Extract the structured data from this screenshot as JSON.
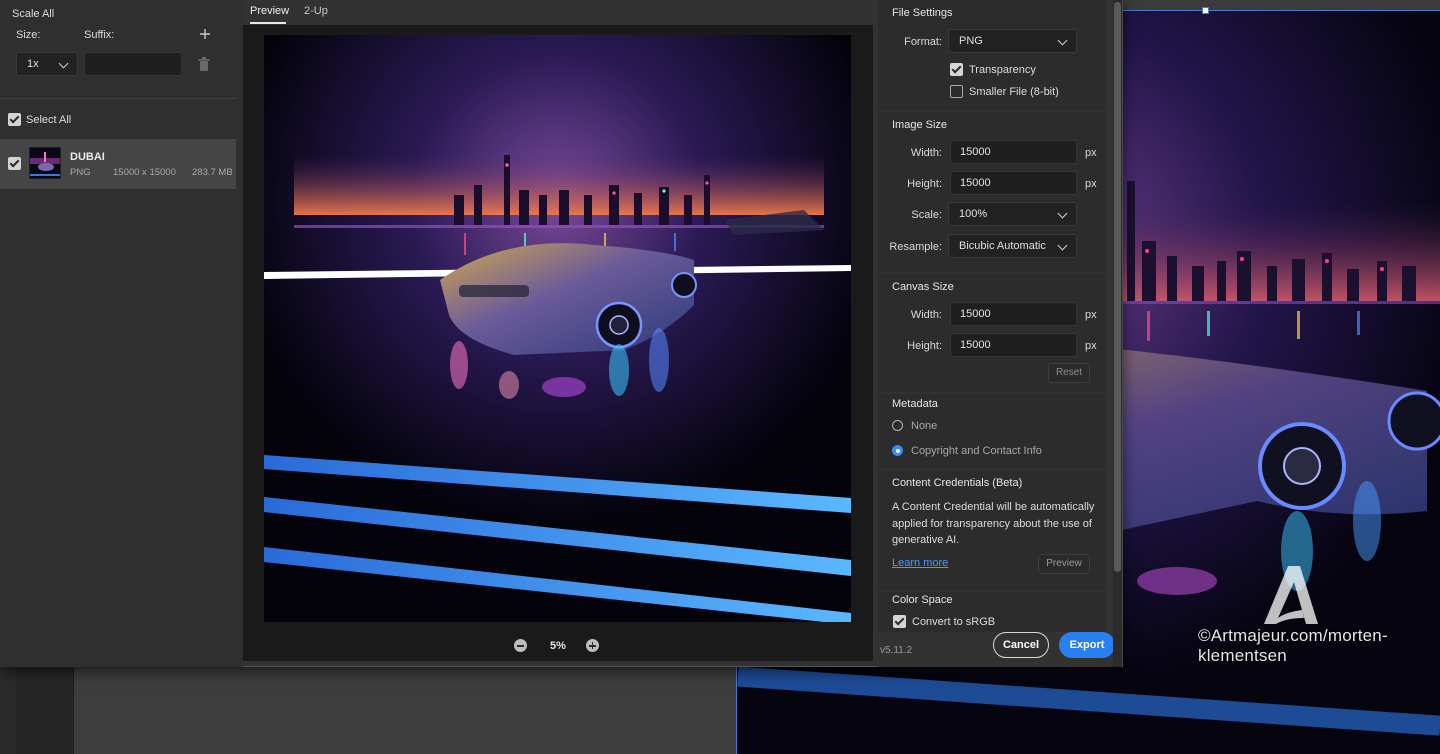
{
  "left": {
    "scale_all": "Scale All",
    "size_label": "Size:",
    "suffix_label": "Suffix:",
    "scale_value": "1x",
    "suffix_value": "",
    "select_all": "Select All",
    "layer": {
      "name": "DUBAI",
      "format": "PNG",
      "dimensions": "15000 x 15000",
      "size": "283.7 MB"
    }
  },
  "preview": {
    "tabs": [
      "Preview",
      "2-Up"
    ],
    "zoom": "5%"
  },
  "settings": {
    "file_settings": {
      "title": "File Settings",
      "format_label": "Format:",
      "format_value": "PNG",
      "transparency": "Transparency",
      "transparency_checked": true,
      "smaller_file": "Smaller File (8-bit)",
      "smaller_file_checked": false
    },
    "image_size": {
      "title": "Image Size",
      "width_label": "Width:",
      "width_value": "15000",
      "height_label": "Height:",
      "height_value": "15000",
      "unit": "px",
      "scale_label": "Scale:",
      "scale_value": "100%",
      "resample_label": "Resample:",
      "resample_value": "Bicubic Automatic"
    },
    "canvas_size": {
      "title": "Canvas Size",
      "width_label": "Width:",
      "width_value": "15000",
      "height_label": "Height:",
      "height_value": "15000",
      "unit": "px",
      "reset": "Reset"
    },
    "metadata": {
      "title": "Metadata",
      "none": "None",
      "copyright": "Copyright and Contact Info",
      "selected": "Copyright and Contact Info"
    },
    "content_credentials": {
      "title": "Content Credentials (Beta)",
      "line1": "A Content Credential will be automatically",
      "line2": "applied for transparency about the use of",
      "line3": "generative AI.",
      "learn_more": "Learn more",
      "preview": "Preview"
    },
    "color_space": {
      "title": "Color Space",
      "convert": "Convert to sRGB",
      "convert_checked": true
    }
  },
  "footer": {
    "version": "v5.11.2",
    "cancel": "Cancel",
    "export": "Export"
  },
  "background": {
    "watermark": "©Artmajeur.com/morten-klementsen"
  },
  "colors": {
    "accent": "#2a7ff0",
    "dialog_bg": "#323232",
    "panel_bg": "#2c2c2c"
  }
}
